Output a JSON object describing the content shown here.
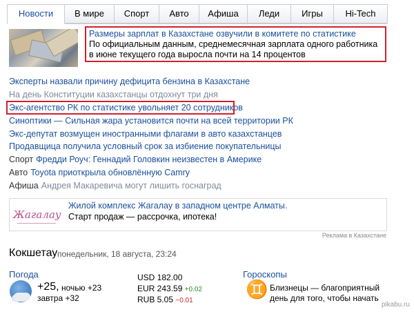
{
  "tabs": [
    {
      "label": "Новости",
      "active": true
    },
    {
      "label": "В мире"
    },
    {
      "label": "Спорт"
    },
    {
      "label": "Авто"
    },
    {
      "label": "Афиша"
    },
    {
      "label": "Леди"
    },
    {
      "label": "Игры"
    },
    {
      "label": "Hi-Tech"
    }
  ],
  "headline": {
    "title": "Размеры зарплат в Казахстане озвучили в комитете по статистике",
    "text": "По официальным данным, среднемесячная зарплата одного работника в июне текущего года выросла почти на 14 процентов"
  },
  "news": [
    {
      "text": "Эксперты назвали причину дефицита бензина в Казахстане"
    },
    {
      "text": "На день Конституции казахстанцы отдохнут три дня"
    },
    {
      "text": "Экс-агентство РК по статистике увольняет 20 сотрудников"
    },
    {
      "text": "Синоптики — Сильная жара установится почти на всей территории РК"
    },
    {
      "text": "Экс-депутат возмущен иностранными флагами в авто казахстанцев"
    },
    {
      "text": "Продавщица получила условный срок за избиение покупательницы"
    },
    {
      "cat": "Спорт",
      "text": "Фредди Роуч: Геннадий Головкин неизвестен в Америке"
    },
    {
      "cat": "Авто",
      "text": "Toyota приоткрыла обновлённую Camry"
    },
    {
      "cat": "Афиша",
      "text": "Андрея Макаревича могут лишить госнаград"
    }
  ],
  "ad": {
    "logo": "Жагалау",
    "title": "Жилой комплекс Жагалау в западном центре Алматы.",
    "subtitle": "Старт продаж — рассрочка, ипотека!",
    "note": "Реклама в Казахстане"
  },
  "location": {
    "city": "Кокшетау",
    "datetime": "понедельник, 18 августа, 23:24"
  },
  "weather": {
    "title": "Погода",
    "temp": "+25,",
    "night": "ночью +23",
    "tomorrow": "завтра +32",
    "icon": "cloudy-night-icon"
  },
  "rates": {
    "usd": "USD 182.00",
    "eur": "EUR 243.59",
    "eur_change": "+0.02",
    "rub": "RUB 5.05",
    "rub_change": "−0.01"
  },
  "horoscope": {
    "title": "Гороскопы",
    "symbol": "♊",
    "line1": "Близнецы — благоприятный",
    "line2": "день для того, чтобы начать"
  },
  "watermark": "pikabu.ru",
  "colors": {
    "link": "#1a4f9c",
    "highlight_box": "#d1202d",
    "muted": "#7e8c9c",
    "up": "#2a8a2a",
    "down": "#c2262e",
    "gemini": "#e7a10f"
  }
}
